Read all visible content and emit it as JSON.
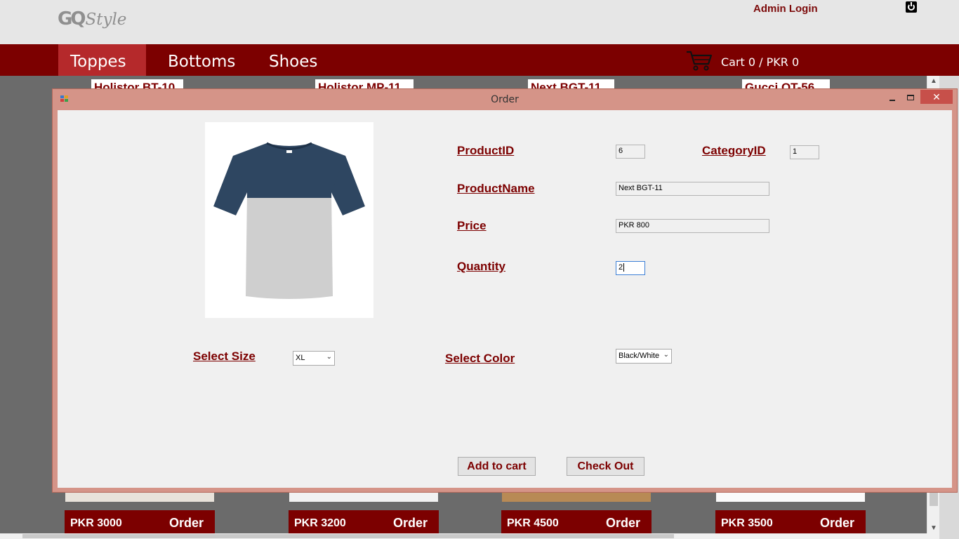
{
  "header": {
    "logo_gq": "GQ",
    "logo_style": "Style",
    "admin_login": "Admin Login"
  },
  "nav": {
    "tabs": [
      {
        "label": "Toppes",
        "active": true
      },
      {
        "label": "Bottoms",
        "active": false
      },
      {
        "label": "Shoes",
        "active": false
      }
    ],
    "cart": "Cart 0 / PKR 0"
  },
  "products": [
    {
      "title": "Holistor BT-10",
      "price": "PKR 3000",
      "order": "Order"
    },
    {
      "title": "Holistor MP-11",
      "price": "PKR 3200",
      "order": "Order"
    },
    {
      "title": "Next BGT-11",
      "price": "PKR 4500",
      "order": "Order"
    },
    {
      "title": "Gucci OT-56",
      "price": "PKR 3500",
      "order": "Order"
    }
  ],
  "dialog": {
    "title": "Order",
    "labels": {
      "product_id": "ProductID",
      "category_id": "CategoryID",
      "product_name": "ProductName",
      "price": "Price",
      "quantity": "Quantity",
      "select_size": "Select Size",
      "select_color": "Select Color"
    },
    "values": {
      "product_id": "6",
      "category_id": "1",
      "product_name": "Next BGT-11",
      "price": "PKR 800",
      "quantity": "2",
      "size": "XL",
      "color": "Black/White"
    },
    "buttons": {
      "add_to_cart": "Add to cart",
      "check_out": "Check Out"
    },
    "close_glyph": "✕"
  },
  "colors": {
    "brand": "#7c0000",
    "active_tab": "#b5292b",
    "dialog_frame": "#d59488",
    "close_button": "#c7504a",
    "tshirt_top": "#2e4661",
    "tshirt_body": "#cfcfcf"
  }
}
